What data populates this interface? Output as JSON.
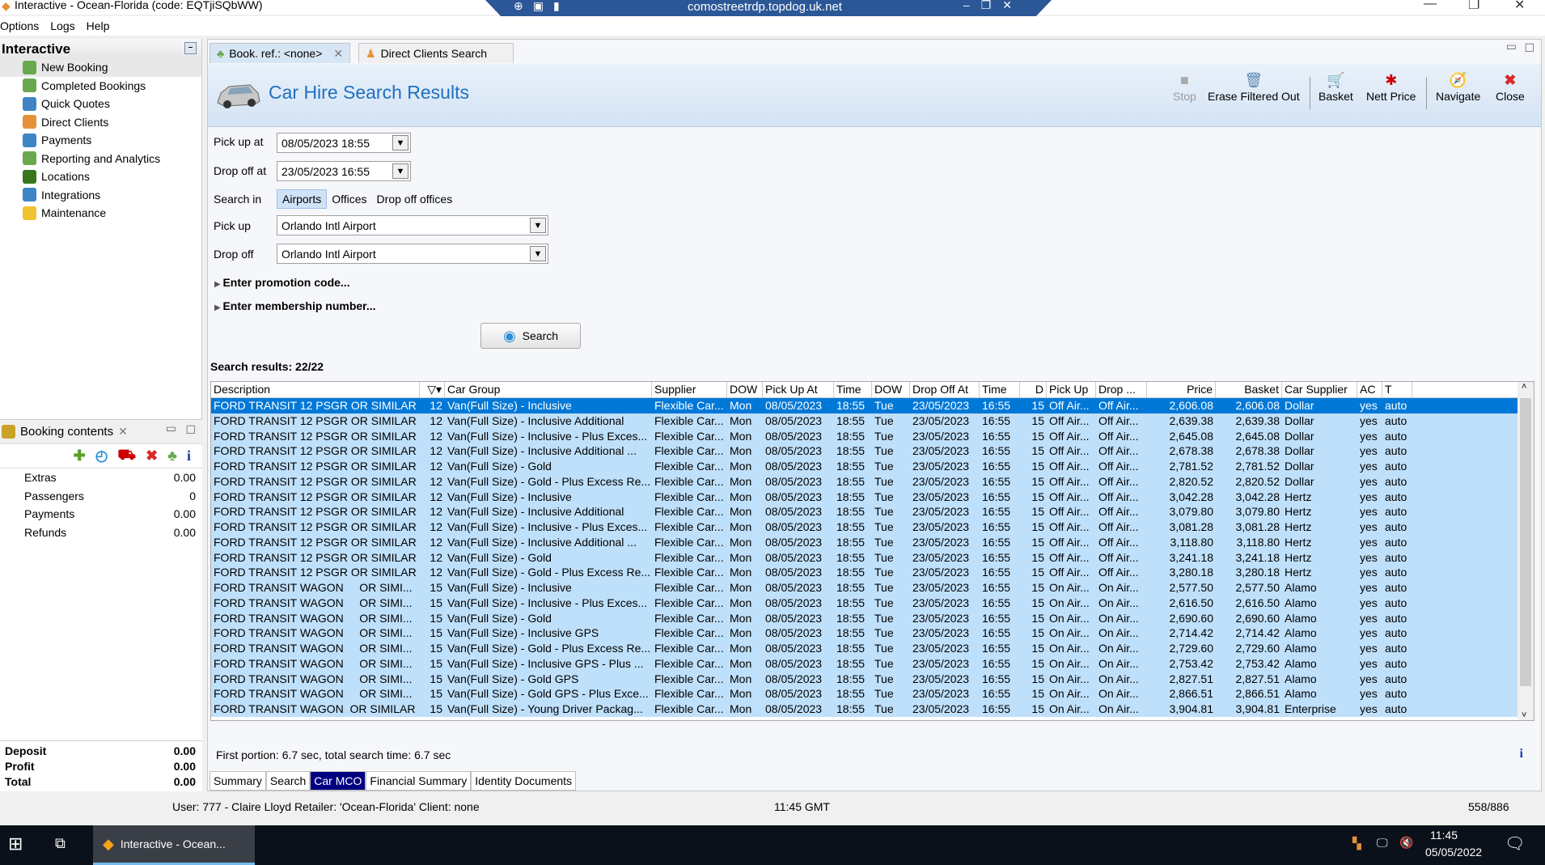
{
  "window": {
    "title": "Interactive - Ocean-Florida (code: EQTjiSQbWW)",
    "rdp_host": "comostreetrdp.topdog.uk.net"
  },
  "menu": [
    "Options",
    "Logs",
    "Help"
  ],
  "sidebar": {
    "title": "Interactive",
    "items": [
      {
        "label": "New Booking",
        "icon": "palm-tree-icon",
        "color": "#6aa84f"
      },
      {
        "label": "Completed Bookings",
        "icon": "palm-tree-icon",
        "color": "#6aa84f"
      },
      {
        "label": "Quick Quotes",
        "icon": "clock-icon",
        "color": "#3d85c6"
      },
      {
        "label": "Direct Clients",
        "icon": "person-icon",
        "color": "#e69138"
      },
      {
        "label": "Payments",
        "icon": "payments-icon",
        "color": "#3d85c6"
      },
      {
        "label": "Reporting and Analytics",
        "icon": "report-icon",
        "color": "#6aa84f"
      },
      {
        "label": "Locations",
        "icon": "map-icon",
        "color": "#38761d"
      },
      {
        "label": "Integrations",
        "icon": "integration-icon",
        "color": "#3d85c6"
      },
      {
        "label": "Maintenance",
        "icon": "maintenance-icon",
        "color": "#f1c232"
      }
    ]
  },
  "booking_contents": {
    "title": "Booking contents",
    "rows": [
      {
        "label": "Extras",
        "value": "0.00"
      },
      {
        "label": "Passengers",
        "value": "0"
      },
      {
        "label": "Payments",
        "value": "0.00"
      },
      {
        "label": "Refunds",
        "value": "0.00"
      }
    ],
    "totals": [
      {
        "label": "Deposit",
        "value": "0.00"
      },
      {
        "label": "Profit",
        "value": "0.00"
      },
      {
        "label": "Total",
        "value": "0.00"
      }
    ]
  },
  "tabs": [
    {
      "label": "Book. ref.: <none>"
    },
    {
      "label": "Direct Clients Search"
    }
  ],
  "page": {
    "title": "Car Hire Search Results"
  },
  "toolbar": {
    "stop": "Stop",
    "erase": "Erase Filtered Out",
    "basket": "Basket",
    "nett": "Nett Price",
    "navigate": "Navigate",
    "close": "Close"
  },
  "form": {
    "pickup_at_label": "Pick up at",
    "pickup_at": "08/05/2023 18:55",
    "dropoff_at_label": "Drop off at",
    "dropoff_at": "23/05/2023 16:55",
    "search_in_label": "Search in",
    "search_in_options": [
      "Airports",
      "Offices",
      "Drop off offices"
    ],
    "search_in_selected": "Airports",
    "pickup_label": "Pick up",
    "pickup": "Orlando Intl Airport",
    "dropoff_label": "Drop off",
    "dropoff": "Orlando Intl Airport",
    "promo": "Enter promotion code...",
    "membership": "Enter membership number...",
    "search_button": "Search"
  },
  "results": {
    "label": "Search results: 22/22",
    "columns": [
      "Description",
      "",
      "Car Group",
      "Supplier",
      "DOW",
      "Pick Up At",
      "Time",
      "DOW",
      "Drop Off At",
      "Time",
      "D",
      "Pick Up",
      "Drop ...",
      "Price",
      "Basket",
      "Car Supplier",
      "AC",
      "T"
    ],
    "rows": [
      [
        "FORD TRANSIT 12 PSGR OR SIMILAR",
        "12",
        "Van(Full Size) - Inclusive",
        "Flexible Car...",
        "Mon",
        "08/05/2023",
        "18:55",
        "Tue",
        "23/05/2023",
        "16:55",
        "15",
        "Off Air...",
        "Off Air...",
        "2,606.08",
        "2,606.08",
        "Dollar",
        "yes",
        "auto"
      ],
      [
        "FORD TRANSIT 12 PSGR OR SIMILAR",
        "12",
        "Van(Full Size) - Inclusive Additional",
        "Flexible Car...",
        "Mon",
        "08/05/2023",
        "18:55",
        "Tue",
        "23/05/2023",
        "16:55",
        "15",
        "Off Air...",
        "Off Air...",
        "2,639.38",
        "2,639.38",
        "Dollar",
        "yes",
        "auto"
      ],
      [
        "FORD TRANSIT 12 PSGR OR SIMILAR",
        "12",
        "Van(Full Size) - Inclusive - Plus Exces...",
        "Flexible Car...",
        "Mon",
        "08/05/2023",
        "18:55",
        "Tue",
        "23/05/2023",
        "16:55",
        "15",
        "Off Air...",
        "Off Air...",
        "2,645.08",
        "2,645.08",
        "Dollar",
        "yes",
        "auto"
      ],
      [
        "FORD TRANSIT 12 PSGR OR SIMILAR",
        "12",
        "Van(Full Size) - Inclusive Additional ...",
        "Flexible Car...",
        "Mon",
        "08/05/2023",
        "18:55",
        "Tue",
        "23/05/2023",
        "16:55",
        "15",
        "Off Air...",
        "Off Air...",
        "2,678.38",
        "2,678.38",
        "Dollar",
        "yes",
        "auto"
      ],
      [
        "FORD TRANSIT 12 PSGR OR SIMILAR",
        "12",
        "Van(Full Size) - Gold",
        "Flexible Car...",
        "Mon",
        "08/05/2023",
        "18:55",
        "Tue",
        "23/05/2023",
        "16:55",
        "15",
        "Off Air...",
        "Off Air...",
        "2,781.52",
        "2,781.52",
        "Dollar",
        "yes",
        "auto"
      ],
      [
        "FORD TRANSIT 12 PSGR OR SIMILAR",
        "12",
        "Van(Full Size) - Gold - Plus Excess Re...",
        "Flexible Car...",
        "Mon",
        "08/05/2023",
        "18:55",
        "Tue",
        "23/05/2023",
        "16:55",
        "15",
        "Off Air...",
        "Off Air...",
        "2,820.52",
        "2,820.52",
        "Dollar",
        "yes",
        "auto"
      ],
      [
        "FORD TRANSIT 12 PSGR OR SIMILAR",
        "12",
        "Van(Full Size) - Inclusive",
        "Flexible Car...",
        "Mon",
        "08/05/2023",
        "18:55",
        "Tue",
        "23/05/2023",
        "16:55",
        "15",
        "Off Air...",
        "Off Air...",
        "3,042.28",
        "3,042.28",
        "Hertz",
        "yes",
        "auto"
      ],
      [
        "FORD TRANSIT 12 PSGR OR SIMILAR",
        "12",
        "Van(Full Size) - Inclusive Additional",
        "Flexible Car...",
        "Mon",
        "08/05/2023",
        "18:55",
        "Tue",
        "23/05/2023",
        "16:55",
        "15",
        "Off Air...",
        "Off Air...",
        "3,079.80",
        "3,079.80",
        "Hertz",
        "yes",
        "auto"
      ],
      [
        "FORD TRANSIT 12 PSGR OR SIMILAR",
        "12",
        "Van(Full Size) - Inclusive - Plus Exces...",
        "Flexible Car...",
        "Mon",
        "08/05/2023",
        "18:55",
        "Tue",
        "23/05/2023",
        "16:55",
        "15",
        "Off Air...",
        "Off Air...",
        "3,081.28",
        "3,081.28",
        "Hertz",
        "yes",
        "auto"
      ],
      [
        "FORD TRANSIT 12 PSGR OR SIMILAR",
        "12",
        "Van(Full Size) - Inclusive Additional ...",
        "Flexible Car...",
        "Mon",
        "08/05/2023",
        "18:55",
        "Tue",
        "23/05/2023",
        "16:55",
        "15",
        "Off Air...",
        "Off Air...",
        "3,118.80",
        "3,118.80",
        "Hertz",
        "yes",
        "auto"
      ],
      [
        "FORD TRANSIT 12 PSGR OR SIMILAR",
        "12",
        "Van(Full Size) - Gold",
        "Flexible Car...",
        "Mon",
        "08/05/2023",
        "18:55",
        "Tue",
        "23/05/2023",
        "16:55",
        "15",
        "Off Air...",
        "Off Air...",
        "3,241.18",
        "3,241.18",
        "Hertz",
        "yes",
        "auto"
      ],
      [
        "FORD TRANSIT 12 PSGR OR SIMILAR",
        "12",
        "Van(Full Size) - Gold - Plus Excess Re...",
        "Flexible Car...",
        "Mon",
        "08/05/2023",
        "18:55",
        "Tue",
        "23/05/2023",
        "16:55",
        "15",
        "Off Air...",
        "Off Air...",
        "3,280.18",
        "3,280.18",
        "Hertz",
        "yes",
        "auto"
      ],
      [
        "FORD TRANSIT WAGON     OR SIMI...",
        "15",
        "Van(Full Size) - Inclusive",
        "Flexible Car...",
        "Mon",
        "08/05/2023",
        "18:55",
        "Tue",
        "23/05/2023",
        "16:55",
        "15",
        "On Air...",
        "On Air...",
        "2,577.50",
        "2,577.50",
        "Alamo",
        "yes",
        "auto"
      ],
      [
        "FORD TRANSIT WAGON     OR SIMI...",
        "15",
        "Van(Full Size) - Inclusive - Plus Exces...",
        "Flexible Car...",
        "Mon",
        "08/05/2023",
        "18:55",
        "Tue",
        "23/05/2023",
        "16:55",
        "15",
        "On Air...",
        "On Air...",
        "2,616.50",
        "2,616.50",
        "Alamo",
        "yes",
        "auto"
      ],
      [
        "FORD TRANSIT WAGON     OR SIMI...",
        "15",
        "Van(Full Size) - Gold",
        "Flexible Car...",
        "Mon",
        "08/05/2023",
        "18:55",
        "Tue",
        "23/05/2023",
        "16:55",
        "15",
        "On Air...",
        "On Air...",
        "2,690.60",
        "2,690.60",
        "Alamo",
        "yes",
        "auto"
      ],
      [
        "FORD TRANSIT WAGON     OR SIMI...",
        "15",
        "Van(Full Size) - Inclusive GPS",
        "Flexible Car...",
        "Mon",
        "08/05/2023",
        "18:55",
        "Tue",
        "23/05/2023",
        "16:55",
        "15",
        "On Air...",
        "On Air...",
        "2,714.42",
        "2,714.42",
        "Alamo",
        "yes",
        "auto"
      ],
      [
        "FORD TRANSIT WAGON     OR SIMI...",
        "15",
        "Van(Full Size) - Gold - Plus Excess Re...",
        "Flexible Car...",
        "Mon",
        "08/05/2023",
        "18:55",
        "Tue",
        "23/05/2023",
        "16:55",
        "15",
        "On Air...",
        "On Air...",
        "2,729.60",
        "2,729.60",
        "Alamo",
        "yes",
        "auto"
      ],
      [
        "FORD TRANSIT WAGON     OR SIMI...",
        "15",
        "Van(Full Size) - Inclusive GPS - Plus ...",
        "Flexible Car...",
        "Mon",
        "08/05/2023",
        "18:55",
        "Tue",
        "23/05/2023",
        "16:55",
        "15",
        "On Air...",
        "On Air...",
        "2,753.42",
        "2,753.42",
        "Alamo",
        "yes",
        "auto"
      ],
      [
        "FORD TRANSIT WAGON     OR SIMI...",
        "15",
        "Van(Full Size) - Gold GPS",
        "Flexible Car...",
        "Mon",
        "08/05/2023",
        "18:55",
        "Tue",
        "23/05/2023",
        "16:55",
        "15",
        "On Air...",
        "On Air...",
        "2,827.51",
        "2,827.51",
        "Alamo",
        "yes",
        "auto"
      ],
      [
        "FORD TRANSIT WAGON     OR SIMI...",
        "15",
        "Van(Full Size) - Gold GPS - Plus Exce...",
        "Flexible Car...",
        "Mon",
        "08/05/2023",
        "18:55",
        "Tue",
        "23/05/2023",
        "16:55",
        "15",
        "On Air...",
        "On Air...",
        "2,866.51",
        "2,866.51",
        "Alamo",
        "yes",
        "auto"
      ],
      [
        "FORD TRANSIT WAGON  OR SIMILAR",
        "15",
        "Van(Full Size) - Young Driver Packag...",
        "Flexible Car...",
        "Mon",
        "08/05/2023",
        "18:55",
        "Tue",
        "23/05/2023",
        "16:55",
        "15",
        "On Air...",
        "On Air...",
        "3,904.81",
        "3,904.81",
        "Enterprise",
        "yes",
        "auto"
      ]
    ],
    "selected_row": 0,
    "timing": "First portion: 6.7 sec, total search time: 6.7 sec"
  },
  "bottom_tabs": [
    "Summary",
    "Search",
    "Car MCO",
    "Financial Summary",
    "Identity Documents"
  ],
  "bottom_tab_selected": "Car MCO",
  "statusbar": {
    "user": "User: 777 - Claire Lloyd   Retailer: 'Ocean-Florida'   Client: none",
    "time": "11:45 GMT",
    "counter": "558/886"
  },
  "taskbar": {
    "app": "Interactive - Ocean...",
    "clock_time": "11:45",
    "clock_date": "05/05/2022"
  },
  "colors": {
    "accent": "#0078d7",
    "row_bg": "#bfe0fb",
    "title": "#1e6fc4",
    "active_tab": "#000080"
  }
}
